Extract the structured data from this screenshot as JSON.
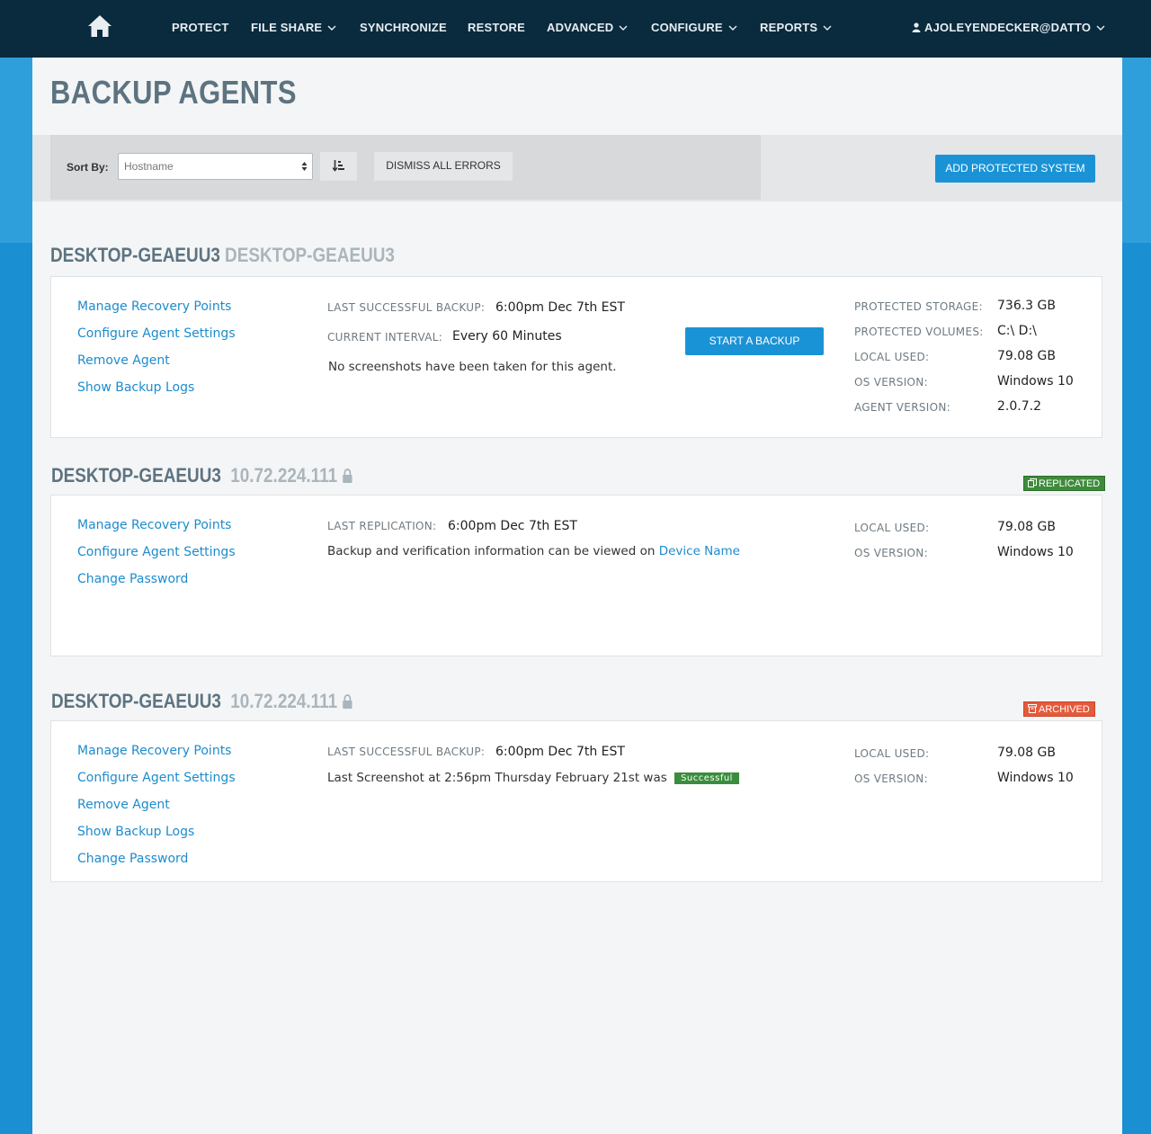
{
  "nav": {
    "items": [
      {
        "label": "PROTECT"
      },
      {
        "label": "FILE SHARE"
      },
      {
        "label": "SYNCHRONIZE"
      },
      {
        "label": "RESTORE"
      },
      {
        "label": "ADVANCED"
      },
      {
        "label": "CONFIGURE"
      },
      {
        "label": "REPORTS"
      }
    ],
    "user": "AJOLEYENDECKER@DATTO"
  },
  "page": {
    "title": "BACKUP AGENTS"
  },
  "toolbar": {
    "sort_label": "Sort By:",
    "sort_value": "Hostname",
    "dismiss_label": "DISMISS ALL ERRORS",
    "add_label": "ADD PROTECTED SYSTEM"
  },
  "agents": [
    {
      "name": "DESKTOP-GEAEUU3",
      "subtitle": "DESKTOP-GEAEUU3",
      "links": [
        "Manage Recovery Points",
        "Configure Agent Settings",
        "Remove Agent",
        "Show Backup Logs"
      ],
      "last_backup_label": "LAST SUCCESSFUL BACKUP:",
      "last_backup_value": "6:00pm Dec 7th EST",
      "interval_label": "CURRENT INTERVAL:",
      "interval_value": "Every 60 Minutes",
      "screenshot_note": "No screenshots have been taken for this agent.",
      "start_label": "START A BACKUP",
      "stats": [
        {
          "label": "PROTECTED STORAGE:",
          "value": "736.3 GB"
        },
        {
          "label": "PROTECTED VOLUMES:",
          "value": "C:\\ D:\\"
        },
        {
          "label": "LOCAL USED:",
          "value": "79.08 GB"
        },
        {
          "label": "OS VERSION:",
          "value": "Windows 10"
        },
        {
          "label": "AGENT VERSION:",
          "value": "2.0.7.2"
        }
      ]
    },
    {
      "name": "DESKTOP-GEAEUU3",
      "subtitle": "10.72.224.111",
      "badge": "REPLICATED",
      "links": [
        "Manage Recovery Points",
        "Configure Agent Settings",
        "Change Password"
      ],
      "last_label": "LAST REPLICATION:",
      "last_value": "6:00pm Dec 7th EST",
      "info_text": "Backup and verification information can be viewed on",
      "info_link": "Device Name",
      "stats": [
        {
          "label": "LOCAL USED:",
          "value": "79.08 GB"
        },
        {
          "label": "OS VERSION:",
          "value": "Windows 10"
        }
      ]
    },
    {
      "name": "DESKTOP-GEAEUU3",
      "subtitle": "10.72.224.111",
      "badge": "ARCHIVED",
      "links": [
        "Manage Recovery Points",
        "Configure Agent Settings",
        "Remove Agent",
        "Show Backup Logs",
        "Change Password"
      ],
      "last_backup_label": "LAST SUCCESSFUL BACKUP:",
      "last_backup_value": "6:00pm Dec 7th EST",
      "screenshot_text": "Last Screenshot at 2:56pm Thursday February 21st was",
      "screenshot_status": "Successful",
      "stats": [
        {
          "label": "LOCAL USED:",
          "value": "79.08 GB"
        },
        {
          "label": "OS VERSION:",
          "value": "Windows 10"
        }
      ]
    }
  ],
  "icons": {
    "home": "home-icon",
    "user": "user-icon",
    "chevron": "chevron-down-icon",
    "lock": "lock-icon",
    "sort": "sort-order-icon",
    "replicated": "copy-icon",
    "archived": "archive-icon"
  },
  "colors": {
    "nav_bg": "#0a2a3d",
    "accent": "#1a93d6",
    "replicated": "#3f8b3c",
    "archived": "#e55a3b"
  }
}
